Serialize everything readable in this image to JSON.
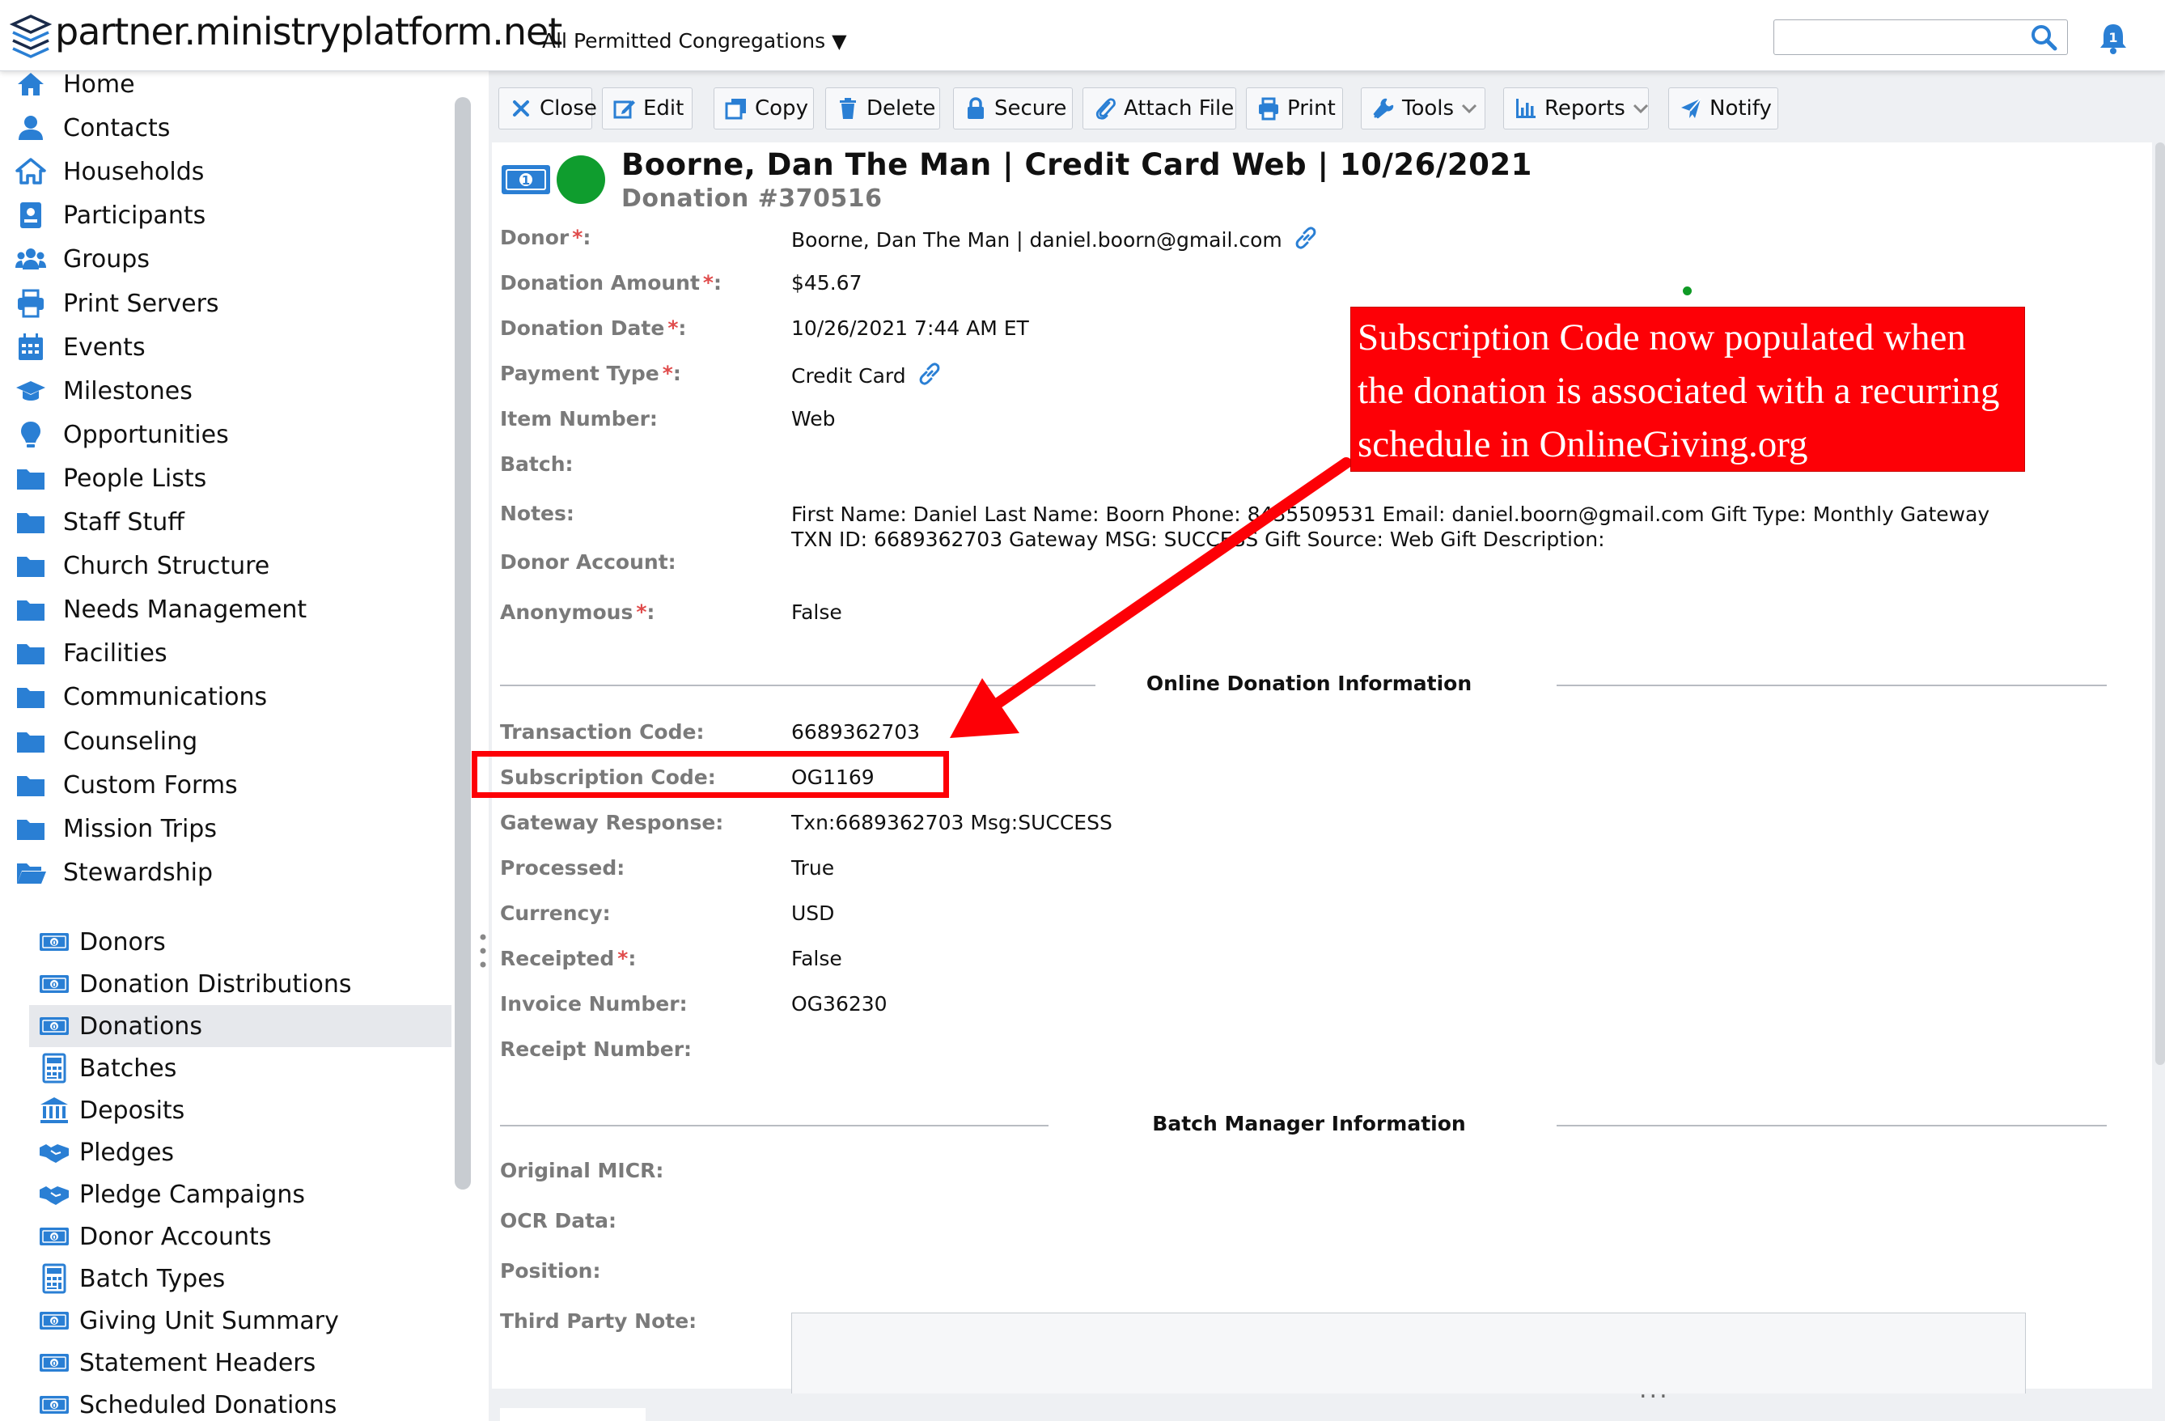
{
  "header": {
    "site_title": "partner.ministryplatform.net",
    "congregation": "All Permitted Congregations",
    "search_value": ""
  },
  "sidebar": {
    "items": [
      {
        "label": "Home",
        "icon": "home-icon"
      },
      {
        "label": "Contacts",
        "icon": "person-icon"
      },
      {
        "label": "Households",
        "icon": "house-icon"
      },
      {
        "label": "Participants",
        "icon": "badge-icon"
      },
      {
        "label": "Groups",
        "icon": "group-icon"
      },
      {
        "label": "Print Servers",
        "icon": "printer-icon"
      },
      {
        "label": "Events",
        "icon": "calendar-icon"
      },
      {
        "label": "Milestones",
        "icon": "graduation-cap-icon"
      },
      {
        "label": "Opportunities",
        "icon": "lightbulb-icon"
      },
      {
        "label": "People Lists",
        "icon": "folder-icon"
      },
      {
        "label": "Staff Stuff",
        "icon": "folder-icon"
      },
      {
        "label": "Church Structure",
        "icon": "folder-icon"
      },
      {
        "label": "Needs Management",
        "icon": "folder-icon"
      },
      {
        "label": "Facilities",
        "icon": "folder-icon"
      },
      {
        "label": "Communications",
        "icon": "folder-icon"
      },
      {
        "label": "Counseling",
        "icon": "folder-icon"
      },
      {
        "label": "Custom Forms",
        "icon": "folder-icon"
      },
      {
        "label": "Mission Trips",
        "icon": "folder-icon"
      },
      {
        "label": "Stewardship",
        "icon": "folder-open-icon"
      }
    ],
    "subitems": [
      {
        "label": "Donors",
        "icon": "money-icon"
      },
      {
        "label": "Donation Distributions",
        "icon": "money-icon"
      },
      {
        "label": "Donations",
        "icon": "money-icon",
        "active": true
      },
      {
        "label": "Batches",
        "icon": "calculator-icon"
      },
      {
        "label": "Deposits",
        "icon": "bank-icon"
      },
      {
        "label": "Pledges",
        "icon": "handshake-icon"
      },
      {
        "label": "Pledge Campaigns",
        "icon": "handshake-icon"
      },
      {
        "label": "Donor Accounts",
        "icon": "money-icon"
      },
      {
        "label": "Batch Types",
        "icon": "calculator-icon"
      },
      {
        "label": "Giving Unit Summary",
        "icon": "money-icon"
      },
      {
        "label": "Statement Headers",
        "icon": "money-icon"
      },
      {
        "label": "Scheduled Donations",
        "icon": "money-icon"
      }
    ]
  },
  "toolbar": {
    "close": "Close",
    "edit": "Edit",
    "copy": "Copy",
    "delete": "Delete",
    "secure": "Secure",
    "attach": "Attach File",
    "print": "Print",
    "tools": "Tools",
    "reports": "Reports",
    "notify": "Notify"
  },
  "record": {
    "title": "Boorne, Dan The Man | Credit Card Web | 10/26/2021",
    "subtitle": "Donation #370516",
    "status_color": "#0f9d2e",
    "fields": [
      {
        "label": "Donor",
        "required": true,
        "value": "Boorne, Dan The Man | daniel.boorn@gmail.com",
        "link": true
      },
      {
        "label": "Donation Amount",
        "required": true,
        "value": "$45.67"
      },
      {
        "label": "Donation Date",
        "required": true,
        "value": "10/26/2021 7:44 AM ET"
      },
      {
        "label": "Payment Type",
        "required": true,
        "value": "Credit Card",
        "link": true
      },
      {
        "label": "Item Number:",
        "required": false,
        "value": "Web"
      },
      {
        "label": "Batch:",
        "required": false,
        "value": ""
      },
      {
        "label": "Notes:",
        "required": false,
        "value": "First Name: Daniel Last Name: Boorn Phone: 8435509531 Email: daniel.boorn@gmail.com Gift Type: Monthly Gateway TXN ID: 6689362703 Gateway MSG: SUCCESS Gift Source: Web Gift Description:"
      },
      {
        "label": "Donor Account:",
        "required": false,
        "value": ""
      },
      {
        "label": "Anonymous",
        "required": true,
        "value": "False"
      }
    ],
    "online_section_title": "Online Donation Information",
    "online_fields": [
      {
        "label": "Transaction Code:",
        "required": false,
        "value": "6689362703"
      },
      {
        "label": "Subscription Code:",
        "required": false,
        "value": "OG1169"
      },
      {
        "label": "Gateway Response:",
        "required": false,
        "value": "Txn:6689362703 Msg:SUCCESS"
      },
      {
        "label": "Processed:",
        "required": false,
        "value": "True"
      },
      {
        "label": "Currency:",
        "required": false,
        "value": "USD"
      },
      {
        "label": "Receipted",
        "required": true,
        "value": "False"
      },
      {
        "label": "Invoice Number:",
        "required": false,
        "value": "OG36230"
      },
      {
        "label": "Receipt Number:",
        "required": false,
        "value": ""
      }
    ],
    "batch_section_title": "Batch Manager Information",
    "batch_fields": [
      {
        "label": "Original MICR:",
        "value": ""
      },
      {
        "label": "OCR Data:",
        "value": ""
      },
      {
        "label": "Position:",
        "value": ""
      },
      {
        "label": "Third Party Note:",
        "value": ""
      }
    ],
    "ellipsis": "..."
  },
  "annotation": {
    "callout_text": "Subscription Code now populated when\nthe donation is associated with a recurring\nschedule in OnlineGiving.org",
    "callout_color": "#fd0006"
  },
  "colors": {
    "accent_blue": "#2a7fd4",
    "label_gray": "#7a7a7a",
    "required_red": "#e04b4b"
  }
}
